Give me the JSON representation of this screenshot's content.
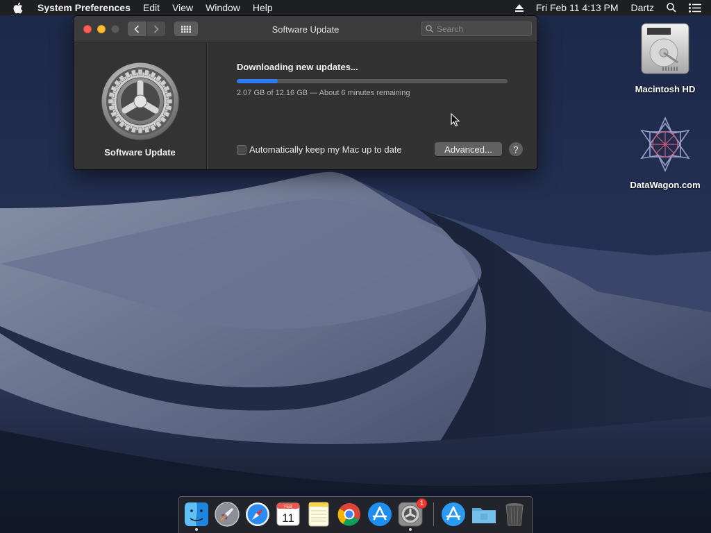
{
  "menubar": {
    "app_name": "System Preferences",
    "items": [
      "Edit",
      "View",
      "Window",
      "Help"
    ],
    "datetime": "Fri Feb 11  4:13 PM",
    "user": "Dartz"
  },
  "window": {
    "title": "Software Update",
    "search_placeholder": "Search",
    "pane_label": "Software Update",
    "status_title": "Downloading new updates...",
    "progress_fraction": 0.15,
    "progress_text": "2.07 GB of 12.16 GB — About 6 minutes remaining",
    "auto_update_label": "Automatically keep my Mac up to date",
    "auto_update_checked": false,
    "advanced_label": "Advanced...",
    "help_label": "?"
  },
  "desktop": {
    "icons": [
      {
        "label": "Macintosh HD",
        "icon": "hard-drive-icon"
      },
      {
        "label": "DataWagon.com",
        "icon": "geometric-star-icon"
      }
    ]
  },
  "dock": {
    "items": [
      {
        "name": "finder",
        "running": true
      },
      {
        "name": "launchpad",
        "running": false
      },
      {
        "name": "safari",
        "running": false
      },
      {
        "name": "calendar",
        "month": "FEB",
        "day": "11",
        "running": false
      },
      {
        "name": "notes",
        "running": false
      },
      {
        "name": "chrome",
        "running": false
      },
      {
        "name": "app-store",
        "running": false
      },
      {
        "name": "system-preferences",
        "badge": "1",
        "running": true
      },
      {
        "name": "app-store-download",
        "running": false
      },
      {
        "name": "downloads-folder",
        "running": false
      },
      {
        "name": "trash",
        "running": false
      }
    ]
  },
  "colors": {
    "accent_blue": "#2f7bf6",
    "close_red": "#fe5f57",
    "minimize_yellow": "#febc2e"
  }
}
